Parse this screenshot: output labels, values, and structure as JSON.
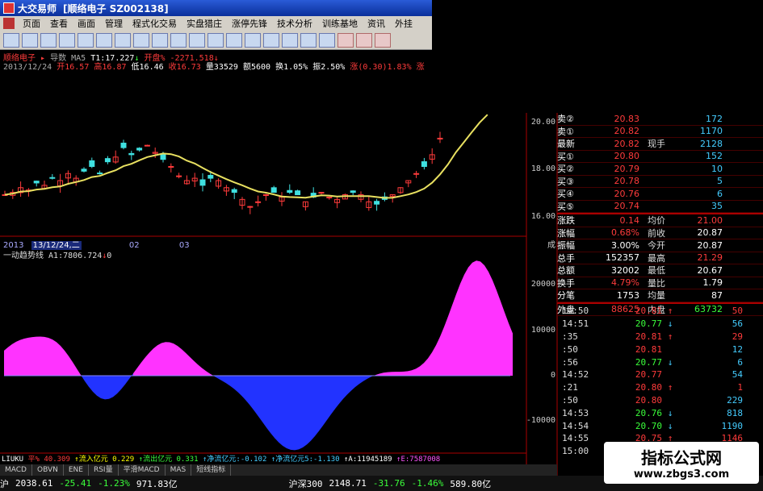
{
  "window": {
    "title_app": "大交易师",
    "title_stock": "[顺络电子 SZ002138]"
  },
  "menu": {
    "items": [
      "页面",
      "查看",
      "画面",
      "管理",
      "程式化交易",
      "实盘猎庄",
      "涨停先锋",
      "技术分析",
      "训练基地",
      "资讯",
      "外挂"
    ]
  },
  "info": {
    "line1": {
      "name": "顺络电子",
      "arrow": "▸",
      "ind": "导数",
      "ma": "MA5",
      "t1": "T1:17.227",
      "t1arrow": "↓",
      "title2": "开盘%",
      "t2val": "-2271.518",
      "t2arrow": "↓"
    },
    "line2": {
      "date": "2013/12/24",
      "open": "开16.57",
      "high": "高16.87",
      "low": "低16.46",
      "close": "收16.73",
      "vol": "量33529",
      "amt": "额5600",
      "turn": "换1.05%",
      "amp": "振2.50%",
      "chg": "涨(0.30)1.83%",
      "extra": "涨"
    }
  },
  "date_axis": {
    "year": "2013",
    "selected": "13/12/24,二",
    "m1": "02",
    "m2": "03"
  },
  "indicator": {
    "label": "一动趋势线",
    "value": "A1:7806.724",
    "arrow": "↓",
    "tail": "0"
  },
  "price_axis": {
    "top": "20.00",
    "mid": "18.00",
    "bot": "16.00",
    "unit": "成"
  },
  "osc_axis": {
    "v1": "20000",
    "v2": "10000",
    "v3": "0",
    "v4": "-10000"
  },
  "capital_bar": {
    "a": "LIUKU",
    "b": "平% 40.309",
    "c": "↑流入亿元 0.229",
    "d": "↑流出亿元 0.331",
    "e": "↑净流亿元:-0.102",
    "f": "↑净流亿元5:-1.130",
    "g": "↑A:11945189",
    "h": "↑E:7587008"
  },
  "tabs": [
    "MACD",
    "OBVN",
    "ENE",
    "RSI量",
    "平滑MACD",
    "MAS",
    "短线指标"
  ],
  "status": {
    "sh_label": "沪",
    "sh_idx": "2038.61",
    "sh_chg": "-25.41",
    "sh_pct": "-1.23%",
    "sh_amt": "971.83亿",
    "hs_label": "沪深300",
    "hs_idx": "2148.71",
    "hs_chg": "-31.76",
    "hs_pct": "-1.46%",
    "hs_amt": "589.80亿"
  },
  "quote": {
    "sells": [
      {
        "label": "卖②",
        "price": "20.83",
        "vol": "172"
      },
      {
        "label": "卖①",
        "price": "20.82",
        "vol": "1170"
      }
    ],
    "latest": {
      "label": "最新",
      "price": "20.82",
      "label2": "现手",
      "vol": "2128"
    },
    "buys": [
      {
        "label": "买①",
        "price": "20.80",
        "vol": "152"
      },
      {
        "label": "买②",
        "price": "20.79",
        "vol": "10"
      },
      {
        "label": "买③",
        "price": "20.78",
        "vol": "5"
      },
      {
        "label": "买④",
        "price": "20.76",
        "vol": "6"
      },
      {
        "label": "买⑤",
        "price": "20.74",
        "vol": "35"
      }
    ],
    "stats": [
      {
        "l1": "涨跌",
        "v1": "0.14",
        "l2": "均价",
        "v2": "21.00"
      },
      {
        "l1": "涨幅",
        "v1": "0.68%",
        "l2": "前收",
        "v2": "20.87"
      },
      {
        "l1": "振幅",
        "v1": "3.00%",
        "l2": "今开",
        "v2": "20.87"
      },
      {
        "l1": "总手",
        "v1": "152357",
        "l2": "最高",
        "v2": "21.29"
      },
      {
        "l1": "总额",
        "v1": "32002",
        "l2": "最低",
        "v2": "20.67"
      },
      {
        "l1": "换手",
        "v1": "4.79%",
        "l2": "量比",
        "v2": "1.79"
      },
      {
        "l1": "分笔",
        "v1": "1753",
        "l2": "均量",
        "v2": "87"
      }
    ],
    "outer": {
      "l1": "外盘",
      "v1": "88625",
      "l2": "内盘",
      "v2": "63732"
    }
  },
  "ticks": [
    {
      "t": "14:50",
      "p": "20.81",
      "a": "↑",
      "v": "50"
    },
    {
      "t": "14:51",
      "p": "20.77",
      "a": "↓",
      "v": "56"
    },
    {
      "t": ":35",
      "p": "20.81",
      "a": "↑",
      "v": "29"
    },
    {
      "t": ":50",
      "p": "20.81",
      "a": "",
      "v": "12"
    },
    {
      "t": ":56",
      "p": "20.77",
      "a": "↓",
      "v": "6"
    },
    {
      "t": "14:52",
      "p": "20.77",
      "a": "",
      "v": "54"
    },
    {
      "t": ":21",
      "p": "20.80",
      "a": "↑",
      "v": "1"
    },
    {
      "t": ":50",
      "p": "20.80",
      "a": "",
      "v": "229"
    },
    {
      "t": "14:53",
      "p": "20.76",
      "a": "↓",
      "v": "818"
    },
    {
      "t": "14:54",
      "p": "20.70",
      "a": "↓",
      "v": "1190"
    },
    {
      "t": "14:55",
      "p": "20.75",
      "a": "↑",
      "v": "1146"
    },
    {
      "t": "15:00",
      "p": "",
      "a": "",
      "v": ""
    }
  ],
  "watermark": {
    "line1": "指标公式网",
    "line2": "www.zbgs3.com"
  },
  "colors": {
    "up": "#ff3b3b",
    "down": "#3bff3b",
    "ma": "#e8e060",
    "pos": "#ff33ff",
    "neg": "#2233ff",
    "bg": "#000000"
  }
}
